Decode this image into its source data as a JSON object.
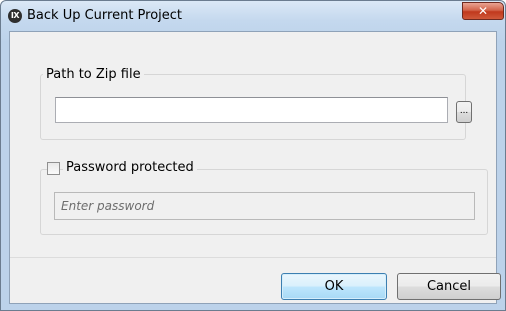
{
  "window": {
    "title": "Back Up Current Project",
    "app_icon_text": "IX",
    "close_symbol": "✕"
  },
  "path_group": {
    "label": "Path to Zip file",
    "path_value": "",
    "browse_label": "..."
  },
  "password_group": {
    "checkbox_label": "Password protected",
    "checked": false,
    "password_placeholder": "Enter password",
    "password_value": ""
  },
  "buttons": {
    "ok_label": "OK",
    "cancel_label": "Cancel"
  },
  "colors": {
    "title_gradient": "#c4d8ee",
    "close_button": "#c0391d",
    "default_button": "#a7d9f5"
  }
}
